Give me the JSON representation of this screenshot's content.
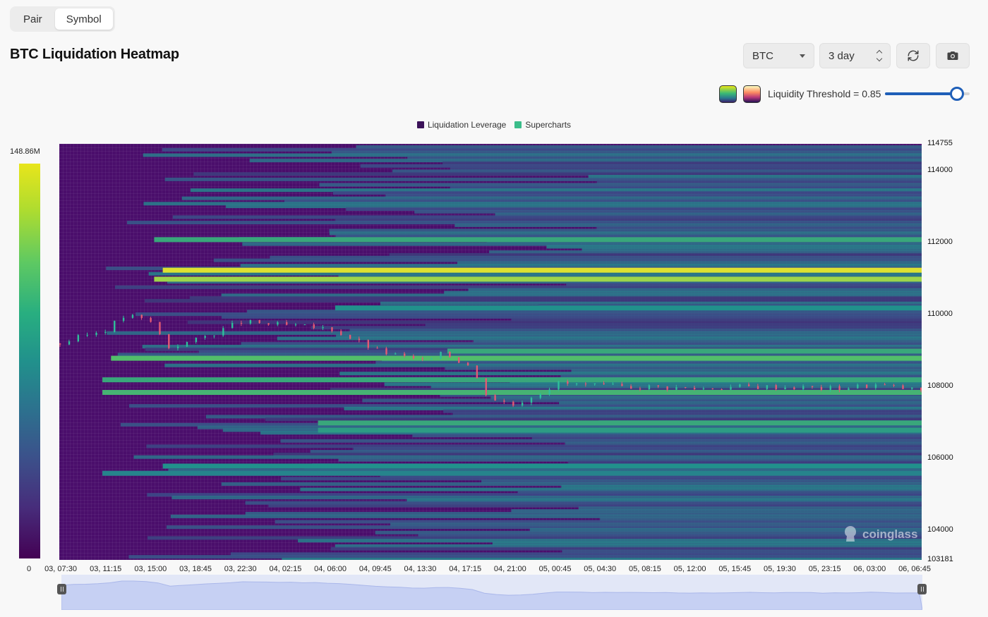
{
  "segmented": {
    "options": [
      "Pair",
      "Symbol"
    ],
    "active": "Symbol"
  },
  "page_title": "BTC Liquidation Heatmap",
  "controls": {
    "coin_select": "BTC",
    "range_select": "3 day",
    "refresh_icon": "refresh-icon",
    "camera_icon": "camera-icon",
    "colormap_options": [
      "viridis",
      "magma"
    ],
    "threshold_label": "Liquidity Threshold = 0.85",
    "threshold_value": 0.85
  },
  "legend": [
    {
      "label": "Liquidation Leverage",
      "color": "#3b1259"
    },
    {
      "label": "Supercharts",
      "color": "#3bbd8a"
    }
  ],
  "colorbar": {
    "max_label": "148.86M",
    "min_label": "0"
  },
  "watermark": "coinglass",
  "chart_data": {
    "type": "heatmap",
    "title": "BTC Liquidation Heatmap",
    "y_ticks": [
      "114755",
      "114000",
      "112000",
      "110000",
      "108000",
      "106000",
      "104000",
      "103181"
    ],
    "ylim": [
      103181,
      114755
    ],
    "x_ticks": [
      "03, 07:30",
      "03, 11:15",
      "03, 15:00",
      "03, 18:45",
      "03, 22:30",
      "04, 02:15",
      "04, 06:00",
      "04, 09:45",
      "04, 13:30",
      "04, 17:15",
      "04, 21:00",
      "05, 00:45",
      "05, 04:30",
      "05, 08:15",
      "05, 12:00",
      "05, 15:45",
      "05, 19:30",
      "05, 23:15",
      "06, 03:00",
      "06, 06:45"
    ],
    "colormap": "viridis",
    "value_range": [
      0,
      148860000
    ],
    "liquidity_bands": [
      {
        "price": 111250,
        "x_start": 0.12,
        "intensity": 0.95
      },
      {
        "price": 111000,
        "x_start": 0.11,
        "intensity": 0.85
      },
      {
        "price": 112100,
        "x_start": 0.11,
        "intensity": 0.6
      },
      {
        "price": 110200,
        "x_start": 0.32,
        "intensity": 0.5
      },
      {
        "price": 109000,
        "x_start": 0.45,
        "intensity": 0.6
      },
      {
        "price": 108800,
        "x_start": 0.06,
        "intensity": 0.7
      },
      {
        "price": 108200,
        "x_start": 0.05,
        "intensity": 0.6
      },
      {
        "price": 107850,
        "x_start": 0.05,
        "intensity": 0.65
      },
      {
        "price": 107000,
        "x_start": 0.3,
        "intensity": 0.6
      },
      {
        "price": 106800,
        "x_start": 0.3,
        "intensity": 0.55
      },
      {
        "price": 105800,
        "x_start": 0.12,
        "intensity": 0.5
      },
      {
        "price": 105600,
        "x_start": 0.05,
        "intensity": 0.45
      }
    ],
    "price_series": {
      "name": "Supercharts",
      "x": [
        "03, 07:30",
        "03, 11:15",
        "03, 13:00",
        "03, 15:00",
        "03, 16:30",
        "03, 18:45",
        "03, 22:30",
        "04, 02:15",
        "04, 06:00",
        "04, 09:45",
        "04, 13:30",
        "04, 15:00",
        "04, 17:15",
        "04, 19:00",
        "04, 21:00",
        "05, 00:45",
        "05, 04:30",
        "05, 08:15",
        "05, 12:00",
        "05, 15:45",
        "05, 19:30",
        "05, 23:15",
        "06, 03:00",
        "06, 06:45"
      ],
      "y": [
        109200,
        109600,
        110000,
        109800,
        109100,
        109300,
        109800,
        109700,
        109600,
        109000,
        108700,
        109000,
        108600,
        107700,
        107500,
        108100,
        108000,
        108000,
        107950,
        108000,
        108000,
        107950,
        108050,
        107900
      ]
    }
  }
}
